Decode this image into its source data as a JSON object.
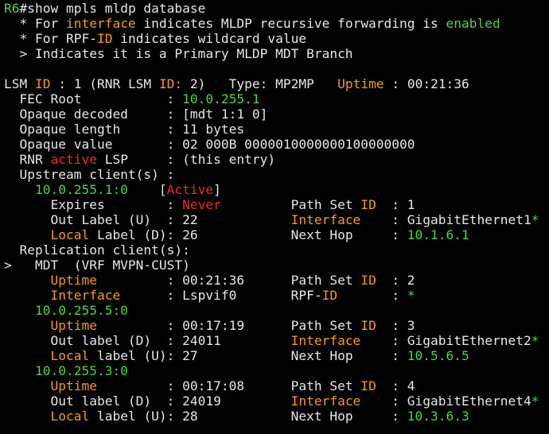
{
  "colors": {
    "background": "#000000",
    "text": "#e6e6e6",
    "green": "#4fd14f",
    "orange": "#f39c12",
    "red": "#ee2a2a"
  },
  "terminal": {
    "lines": [
      [
        {
          "t": "R6",
          "c": "g"
        },
        {
          "t": "#show mpls mldp database",
          "c": "w"
        }
      ],
      [
        {
          "t": "  * For ",
          "c": "w"
        },
        {
          "t": "interface",
          "c": "o"
        },
        {
          "t": " indicates MLDP recursive forwarding is ",
          "c": "w"
        },
        {
          "t": "enabled",
          "c": "g"
        }
      ],
      [
        {
          "t": "  * For RPF-",
          "c": "w"
        },
        {
          "t": "ID",
          "c": "o"
        },
        {
          "t": " indicates wildcard value",
          "c": "w"
        }
      ],
      [
        {
          "t": "  > Indicates it is a Primary MLDP MDT Branch",
          "c": "w"
        }
      ],
      [
        {
          "t": "",
          "c": "w"
        }
      ],
      [
        {
          "t": "LSM ",
          "c": "w"
        },
        {
          "t": "ID",
          "c": "o"
        },
        {
          "t": " : 1 (RNR LSM ",
          "c": "w"
        },
        {
          "t": "ID:",
          "c": "o"
        },
        {
          "t": " 2)   Type: MP2MP   ",
          "c": "w"
        },
        {
          "t": "Uptime",
          "c": "o"
        },
        {
          "t": " : 00:21:36",
          "c": "w"
        }
      ],
      [
        {
          "t": "  FEC Root           : ",
          "c": "w"
        },
        {
          "t": "10.0.255.1",
          "c": "g"
        }
      ],
      [
        {
          "t": "  Opaque decoded     : [mdt 1:1 0]",
          "c": "w"
        }
      ],
      [
        {
          "t": "  Opaque length      : 11 bytes",
          "c": "w"
        }
      ],
      [
        {
          "t": "  Opaque value       : 02 000B 0000010000000100000000",
          "c": "w"
        }
      ],
      [
        {
          "t": "  RNR ",
          "c": "w"
        },
        {
          "t": "active",
          "c": "r"
        },
        {
          "t": " LSP     : (this entry)",
          "c": "w"
        }
      ],
      [
        {
          "t": "  Upstream client(s) :",
          "c": "w"
        }
      ],
      [
        {
          "t": "    ",
          "c": "w"
        },
        {
          "t": "10.0.255.1:0",
          "c": "g"
        },
        {
          "t": "    [",
          "c": "w"
        },
        {
          "t": "Active",
          "c": "r"
        },
        {
          "t": "]",
          "c": "w"
        }
      ],
      [
        {
          "t": "      Expires        : ",
          "c": "w"
        },
        {
          "t": "Never",
          "c": "r"
        },
        {
          "t": "         Path Set ",
          "c": "w"
        },
        {
          "t": "ID",
          "c": "o"
        },
        {
          "t": "  : 1",
          "c": "w"
        }
      ],
      [
        {
          "t": "      Out Label (U)  : 22            ",
          "c": "w"
        },
        {
          "t": "Interface",
          "c": "o"
        },
        {
          "t": "    : GigabitEthernet1",
          "c": "w"
        },
        {
          "t": "*",
          "c": "g"
        }
      ],
      [
        {
          "t": "      ",
          "c": "w"
        },
        {
          "t": "Local",
          "c": "o"
        },
        {
          "t": " Label (D): 26            Next Hop     : ",
          "c": "w"
        },
        {
          "t": "10.1.6.1",
          "c": "g"
        }
      ],
      [
        {
          "t": "  Replication client(s):",
          "c": "w"
        }
      ],
      [
        {
          "t": ">   MDT  (VRF MVPN-CUST)",
          "c": "w"
        }
      ],
      [
        {
          "t": "      ",
          "c": "w"
        },
        {
          "t": "Uptime",
          "c": "o"
        },
        {
          "t": "         : 00:21:36      Path Set ",
          "c": "w"
        },
        {
          "t": "ID",
          "c": "o"
        },
        {
          "t": "  : 2",
          "c": "w"
        }
      ],
      [
        {
          "t": "      ",
          "c": "w"
        },
        {
          "t": "Interface",
          "c": "o"
        },
        {
          "t": "      : Lspvif0       RPF-",
          "c": "w"
        },
        {
          "t": "ID",
          "c": "o"
        },
        {
          "t": "       : ",
          "c": "w"
        },
        {
          "t": "*",
          "c": "g"
        }
      ],
      [
        {
          "t": "    ",
          "c": "w"
        },
        {
          "t": "10.0.255.5:0",
          "c": "g"
        }
      ],
      [
        {
          "t": "      ",
          "c": "w"
        },
        {
          "t": "Uptime",
          "c": "o"
        },
        {
          "t": "         : 00:17:19      Path Set ",
          "c": "w"
        },
        {
          "t": "ID",
          "c": "o"
        },
        {
          "t": "  : 3",
          "c": "w"
        }
      ],
      [
        {
          "t": "      Out label (D)  : 24011         ",
          "c": "w"
        },
        {
          "t": "Interface",
          "c": "o"
        },
        {
          "t": "    : GigabitEthernet2",
          "c": "w"
        },
        {
          "t": "*",
          "c": "g"
        }
      ],
      [
        {
          "t": "      ",
          "c": "w"
        },
        {
          "t": "Local",
          "c": "o"
        },
        {
          "t": " label (U): 27            Next Hop     : ",
          "c": "w"
        },
        {
          "t": "10.5.6.5",
          "c": "g"
        }
      ],
      [
        {
          "t": "    ",
          "c": "w"
        },
        {
          "t": "10.0.255.3:0",
          "c": "g"
        }
      ],
      [
        {
          "t": "      ",
          "c": "w"
        },
        {
          "t": "Uptime",
          "c": "o"
        },
        {
          "t": "         : 00:17:08      Path Set ",
          "c": "w"
        },
        {
          "t": "ID",
          "c": "o"
        },
        {
          "t": "  : 4",
          "c": "w"
        }
      ],
      [
        {
          "t": "      Out label (D)  : 24019         ",
          "c": "w"
        },
        {
          "t": "Interface",
          "c": "o"
        },
        {
          "t": "    : GigabitEthernet4",
          "c": "w"
        },
        {
          "t": "*",
          "c": "g"
        }
      ],
      [
        {
          "t": "      ",
          "c": "w"
        },
        {
          "t": "Local",
          "c": "o"
        },
        {
          "t": " label (U): 28            Next Hop     : ",
          "c": "w"
        },
        {
          "t": "10.3.6.3",
          "c": "g"
        }
      ]
    ]
  }
}
